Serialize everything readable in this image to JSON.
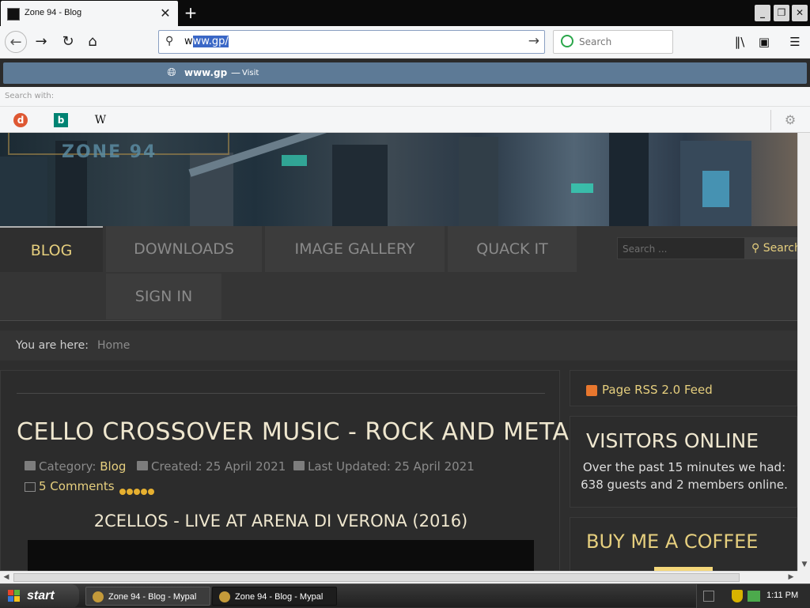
{
  "browser": {
    "tab_title": "Zone 94 - Blog",
    "url_typed": "w",
    "url_autofill": "ww.gp/",
    "search_placeholder": "Search"
  },
  "autocomplete": {
    "url": "www.gp",
    "dash": "—",
    "action": "Visit",
    "search_with_label": "Search with:",
    "engines": [
      "DuckDuckGo",
      "Bing",
      "Wikipedia"
    ]
  },
  "site": {
    "nav": [
      "BLOG",
      "DOWNLOADS",
      "IMAGE GALLERY",
      "QUACK IT",
      "SIGN IN"
    ],
    "search_placeholder": "Search ...",
    "search_button": "Search",
    "breadcrumb_label": "You are here:",
    "breadcrumb_home": "Home"
  },
  "article": {
    "title": "CELLO CROSSOVER MUSIC - ROCK AND METAL",
    "category_label": "Category:",
    "category": "Blog",
    "created": "Created: 25 April 2021",
    "updated": "Last Updated: 25 April 2021",
    "comments": "5 Comments",
    "rating": 5,
    "subtitle": "2CELLOS - LIVE AT ARENA DI VERONA (2016)"
  },
  "sidebar": {
    "rss": "Page RSS 2.0 Feed",
    "visitors_title": "VISITORS ONLINE",
    "visitors_line1": "Over the past 15 minutes we had:",
    "visitors_line2": "638 guests and 2 members online.",
    "coffee_title": "BUY ME A COFFEE"
  },
  "taskbar": {
    "start": "start",
    "tasks": [
      "Zone 94 - Blog - Mypal",
      "Zone 94 - Blog - Mypal"
    ],
    "clock": "1:11 PM"
  },
  "colors": {
    "accent_gold": "#e6cf7e",
    "autocomplete_highlight": "#5d7a96",
    "page_bg": "#2e2e2e"
  }
}
